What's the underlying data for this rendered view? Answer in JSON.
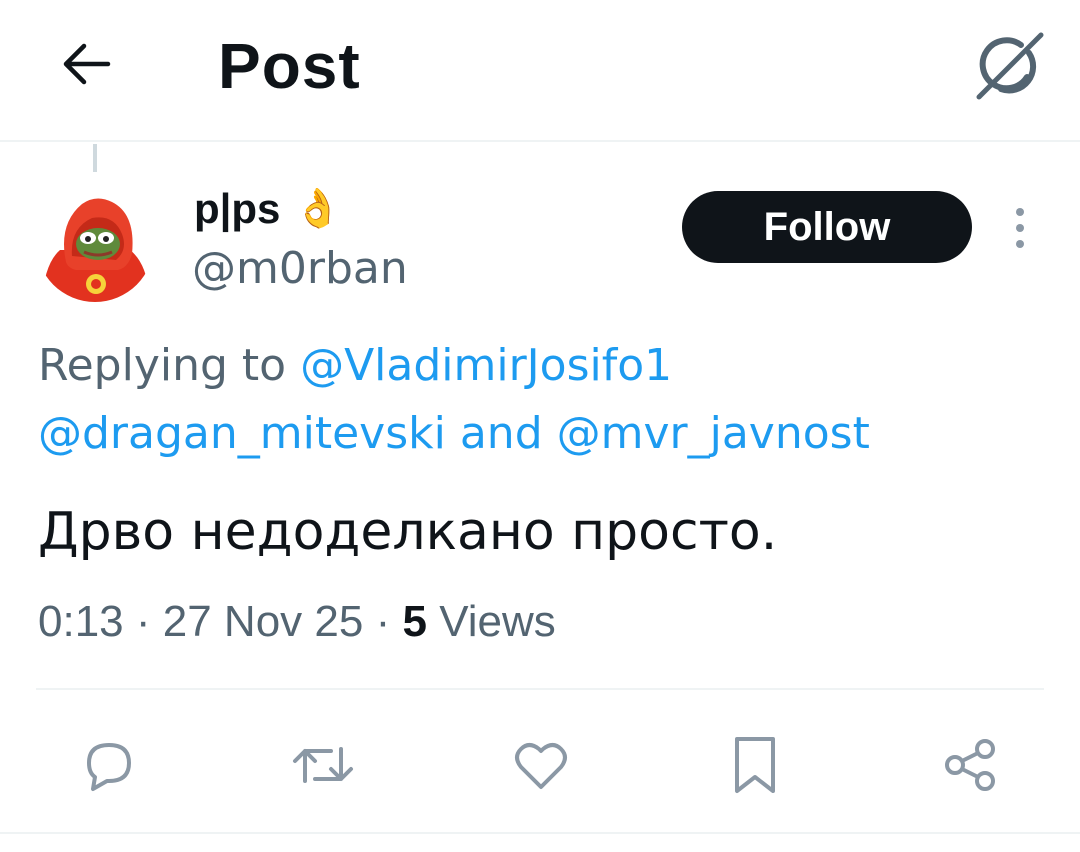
{
  "header": {
    "title": "Post",
    "back_icon": "arrow-left-icon",
    "grok_icon": "grok-icon"
  },
  "post": {
    "author": {
      "display_name": "p|ps",
      "emoji": "👌",
      "handle": "@m0rban"
    },
    "follow_label": "Follow",
    "replying": {
      "prefix": "Replying to",
      "mention_1": "@VladimirJosifo1",
      "mention_2": "@dragan_mitevski",
      "conjunction": "and",
      "mention_3": "@mvr_javnost"
    },
    "text": "Дрво недоделкано просто.",
    "meta": {
      "time": "0:13",
      "sep1": "·",
      "date": "27 Nov 25",
      "sep2": "·",
      "views_count": "5",
      "views_label": "Views"
    }
  },
  "actions": [
    "reply-icon",
    "repost-icon",
    "like-icon",
    "bookmark-icon",
    "share-icon"
  ],
  "colors": {
    "accent": "#1d9bf0",
    "text": "#0f1419",
    "secondary": "#536471",
    "border": "#eff3f4",
    "follow_bg": "#0f1419"
  }
}
